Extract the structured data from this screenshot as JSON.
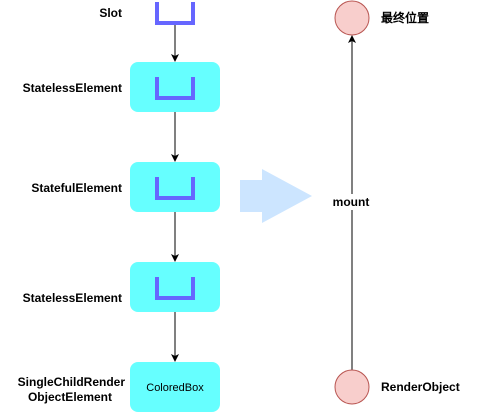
{
  "left": {
    "slot_label": "Slot",
    "nodes": [
      {
        "label": "StatelessElement"
      },
      {
        "label": "StatefulElement"
      },
      {
        "label": "StatelessElement"
      },
      {
        "label_line1": "SingleChildRender",
        "label_line2": "ObjectElement",
        "box_text": "ColoredBox"
      }
    ]
  },
  "right": {
    "top_label": "最终位置",
    "bottom_label": "RenderObject",
    "edge_label": "mount"
  },
  "colors": {
    "box": "#66ffff",
    "slot": "#6666ff",
    "circle": "#f8cecc",
    "big_arrow": "#cce5ff"
  }
}
